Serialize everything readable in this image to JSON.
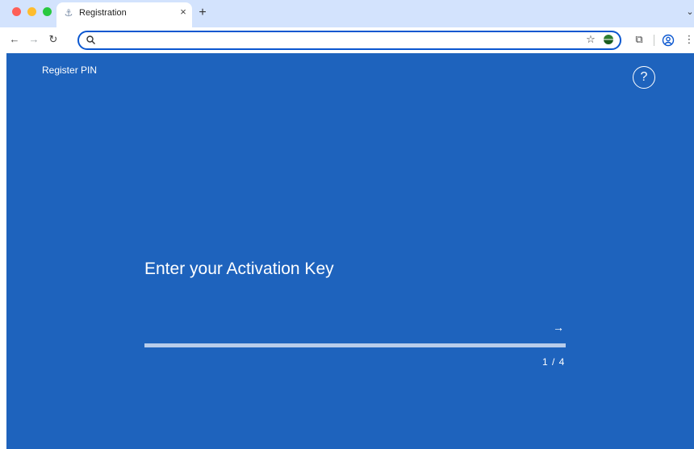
{
  "browser": {
    "tab": {
      "title": "Registration",
      "favicon": "anchor-icon",
      "close": "×"
    },
    "new_tab": "+",
    "tab_search": "⌄",
    "toolbar": {
      "back": "←",
      "forward": "→",
      "reload": "↻",
      "address_value": "",
      "star": "☆",
      "extensions": "⧉",
      "menu": "⋮"
    }
  },
  "page": {
    "title": "Register PIN",
    "help": "?",
    "heading": "Enter your Activation Key",
    "key_value": "",
    "next": "→",
    "step": "1 / 4",
    "progress": 1.0,
    "accent": "#1e63bd"
  }
}
